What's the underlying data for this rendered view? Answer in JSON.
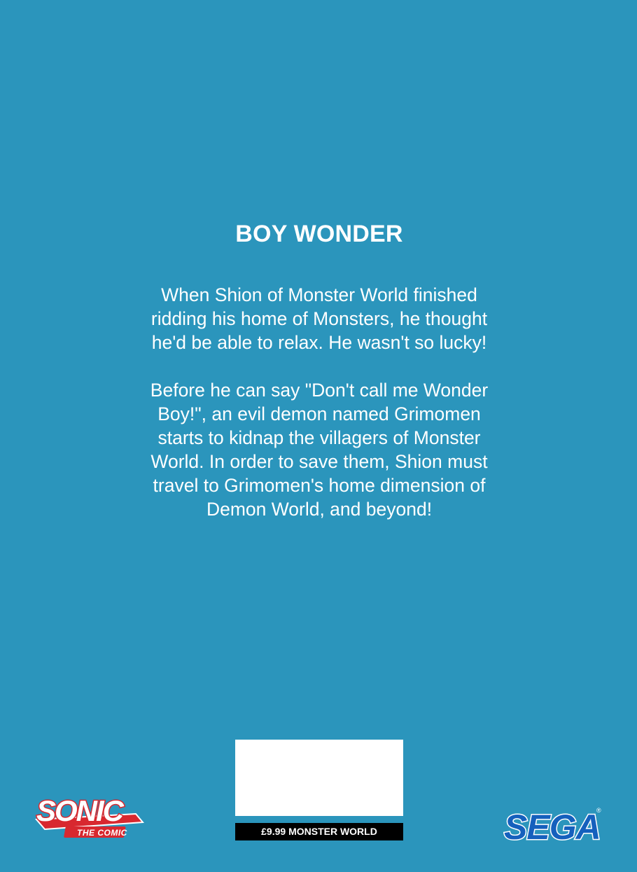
{
  "cover": {
    "title": "BOY WONDER",
    "paragraphs": [
      "When Shion of Monster World finished ridding his home of Monsters, he thought he'd be able to relax. He wasn't so lucky!",
      "Before he can say \"Don't call me Wonder Boy!\", an evil demon named Grimomen starts to kidnap the villagers of Monster World. In order to save them, Shion must travel to Grimomen's home dimension of Demon World, and beyond!"
    ]
  },
  "barcode": {
    "price_label": "£9.99 MONSTER WORLD"
  },
  "logos": {
    "sonic": {
      "word": "SONIC",
      "subtitle": "THE COMIC"
    },
    "sega": {
      "word": "SEGA",
      "mark": "®"
    }
  },
  "colors": {
    "background": "#2b95bc",
    "text": "#ffffff",
    "sega_blue": "#1560bd",
    "sonic_red": "#d8282f"
  }
}
